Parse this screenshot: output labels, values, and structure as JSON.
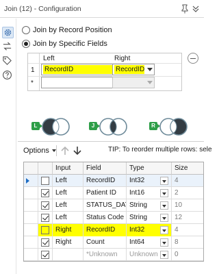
{
  "window": {
    "title": "Join (12) - Configuration"
  },
  "left_tools": [
    {
      "icon": "gear-icon",
      "selected": true
    },
    {
      "icon": "exchange-icon",
      "selected": false
    },
    {
      "icon": "tag-icon",
      "selected": false
    },
    {
      "icon": "help-icon",
      "selected": false
    }
  ],
  "join_mode": {
    "by_position_label": "Join by Record Position",
    "by_fields_label": "Join by Specific Fields",
    "selected": "by_fields"
  },
  "field_map": {
    "left_header": "Left",
    "right_header": "Right",
    "rows": [
      {
        "num": "1",
        "left": "RecordID",
        "right": "RecordID"
      },
      {
        "num": "*",
        "left": "",
        "right": ""
      }
    ]
  },
  "venn": [
    {
      "badge": "L"
    },
    {
      "badge": "J"
    },
    {
      "badge": "R"
    }
  ],
  "toolbar": {
    "options_label": "Options",
    "tip": "TIP: To reorder multiple rows: sele"
  },
  "grid": {
    "columns": [
      "Input",
      "Field",
      "Type",
      "Size"
    ],
    "rows": [
      {
        "checked": false,
        "input": "Left",
        "field": "RecordID",
        "type": "Int32",
        "size": "4",
        "selected": true,
        "highlight": false,
        "grey": false
      },
      {
        "checked": true,
        "input": "Left",
        "field": "Patient ID",
        "type": "Int16",
        "size": "2",
        "selected": false,
        "highlight": false,
        "grey": false
      },
      {
        "checked": true,
        "input": "Left",
        "field": "STATUS_DATE",
        "type": "String",
        "size": "10",
        "selected": false,
        "highlight": false,
        "grey": false
      },
      {
        "checked": true,
        "input": "Left",
        "field": "Status Code",
        "type": "String",
        "size": "12",
        "selected": false,
        "highlight": false,
        "grey": false
      },
      {
        "checked": false,
        "input": "Right",
        "field": "RecordID",
        "type": "Int32",
        "size": "4",
        "selected": false,
        "highlight": true,
        "grey": false
      },
      {
        "checked": true,
        "input": "Right",
        "field": "Count",
        "type": "Int64",
        "size": "8",
        "selected": false,
        "highlight": false,
        "grey": false
      },
      {
        "checked": true,
        "input": "",
        "field": "*Unknown",
        "type": "Unknown",
        "size": "0",
        "selected": false,
        "highlight": false,
        "grey": true
      }
    ]
  }
}
